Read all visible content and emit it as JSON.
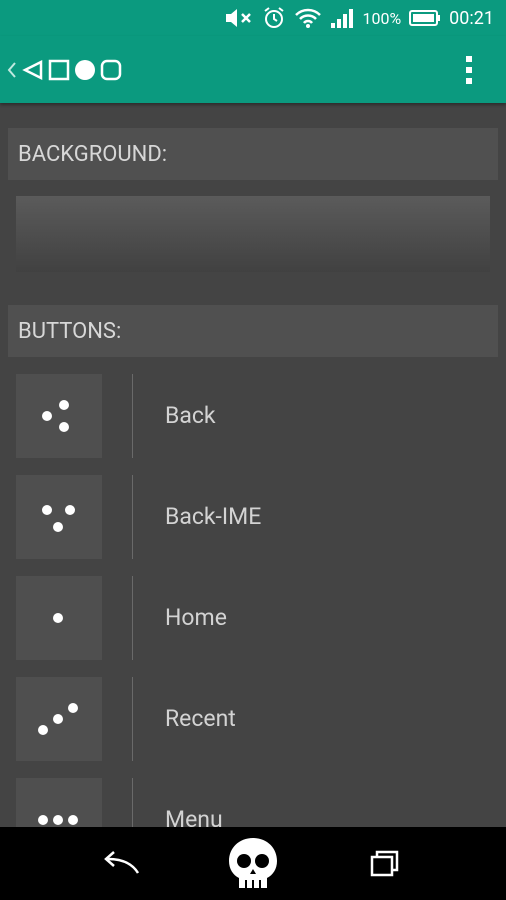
{
  "status_bar": {
    "battery_percent": "100%",
    "time": "00:21",
    "icons": [
      "mute-icon",
      "alarm-icon",
      "wifi-icon",
      "signal-icon",
      "battery-icon"
    ]
  },
  "app_bar": {
    "logo_icons": [
      "chevron-left-icon",
      "triangle-back-icon",
      "square-icon",
      "circle-icon",
      "rounded-square-icon"
    ],
    "menu_icon": "overflow-menu-icon"
  },
  "sections": {
    "background_label": "BACKGROUND:",
    "buttons_label": "BUTTONS:"
  },
  "buttons": [
    {
      "label": "Back",
      "icon": "dots-back-icon"
    },
    {
      "label": "Back-IME",
      "icon": "dots-back-ime-icon"
    },
    {
      "label": "Home",
      "icon": "dot-home-icon"
    },
    {
      "label": "Recent",
      "icon": "dots-recent-icon"
    },
    {
      "label": "Menu",
      "icon": "dots-menu-icon"
    }
  ],
  "nav_bar": {
    "icons": [
      "back-arrow-icon",
      "skull-home-icon",
      "recent-apps-icon"
    ]
  },
  "colors": {
    "accent": "#0b9a7f",
    "background": "#444444",
    "header": "#505050"
  }
}
